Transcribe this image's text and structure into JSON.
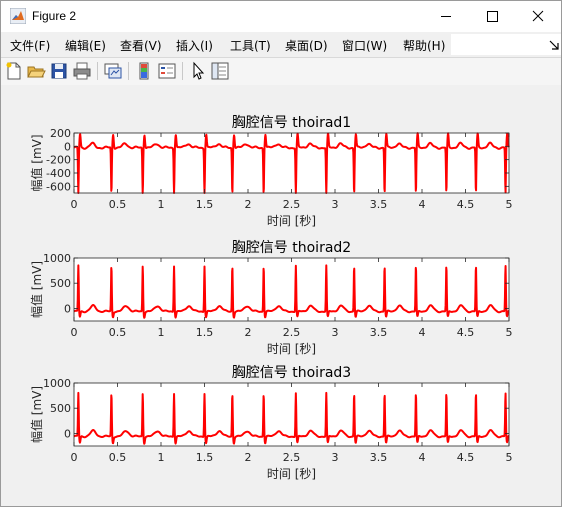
{
  "window": {
    "title": "Figure 2"
  },
  "menu": [
    "文件(F)",
    "编辑(E)",
    "查看(V)",
    "插入(I)",
    "工具(T)",
    "桌面(D)",
    "窗口(W)",
    "帮助(H)"
  ],
  "toolbar_icons": [
    "new-figure-icon",
    "open-folder-icon",
    "save-icon",
    "print-icon",
    "link-plot-icon",
    "insert-colorbar-icon",
    "insert-legend-icon",
    "pointer-icon",
    "property-inspector-icon"
  ],
  "colors": {
    "signal": "#ff0000",
    "axes_bg": "#ffffff",
    "figure_bg": "#f0f0f0"
  },
  "axes": [
    {
      "title": "胸腔信号 thoirad1",
      "ylabel": "幅值 [mV]",
      "xlabel": "时间 [秒]",
      "yticks": [
        "200",
        "0",
        "-200",
        "-400",
        "-600"
      ],
      "xticks": [
        "0",
        "0.5",
        "1",
        "1.5",
        "2",
        "2.5",
        "3",
        "3.5",
        "4",
        "4.5",
        "5"
      ]
    },
    {
      "title": "胸腔信号 thoirad2",
      "ylabel": "幅值 [mV]",
      "xlabel": "时间 [秒]",
      "yticks": [
        "1000",
        "500",
        "0"
      ],
      "xticks": [
        "0",
        "0.5",
        "1",
        "1.5",
        "2",
        "2.5",
        "3",
        "3.5",
        "4",
        "4.5",
        "5"
      ]
    },
    {
      "title": "胸腔信号 thoirad3",
      "ylabel": "幅值 [mV]",
      "xlabel": "时间 [秒]",
      "yticks": [
        "1000",
        "500",
        "0"
      ],
      "xticks": [
        "0",
        "0.5",
        "1",
        "1.5",
        "2",
        "2.5",
        "3",
        "3.5",
        "4",
        "4.5",
        "5"
      ]
    }
  ],
  "chart_data": [
    {
      "type": "line",
      "title": "胸腔信号 thoirad1",
      "xlabel": "时间 [秒]",
      "ylabel": "幅值 [mV]",
      "xlim": [
        0,
        5
      ],
      "ylim": [
        -700,
        200
      ],
      "grid": false,
      "series": [
        {
          "color": "#ff0000",
          "beats_x": [
            0.05,
            0.43,
            0.79,
            1.15,
            1.5,
            1.82,
            2.18,
            2.55,
            2.9,
            3.22,
            3.57,
            3.93,
            4.28,
            4.62,
            4.96
          ],
          "r_min": -690,
          "s_peak": 180,
          "baseline": -20
        }
      ]
    },
    {
      "type": "line",
      "title": "胸腔信号 thoirad2",
      "xlabel": "时间 [秒]",
      "ylabel": "幅值 [mV]",
      "xlim": [
        0,
        5
      ],
      "ylim": [
        -250,
        1000
      ],
      "grid": false,
      "series": [
        {
          "color": "#ff0000",
          "beats_x": [
            0.05,
            0.43,
            0.79,
            1.15,
            1.5,
            1.82,
            2.18,
            2.55,
            2.9,
            3.22,
            3.57,
            3.93,
            4.28,
            4.62,
            4.96
          ],
          "r_peak": 850,
          "q_min": -170,
          "baseline": -60
        }
      ]
    },
    {
      "type": "line",
      "title": "胸腔信号 thoirad3",
      "xlabel": "时间 [秒]",
      "ylabel": "幅值 [mV]",
      "xlim": [
        0,
        5
      ],
      "ylim": [
        -250,
        1000
      ],
      "grid": false,
      "series": [
        {
          "color": "#ff0000",
          "beats_x": [
            0.05,
            0.43,
            0.79,
            1.15,
            1.5,
            1.82,
            2.18,
            2.55,
            2.9,
            3.22,
            3.57,
            3.93,
            4.28,
            4.62,
            4.96
          ],
          "r_peak": 800,
          "q_min": -190,
          "baseline": -60
        }
      ]
    }
  ]
}
